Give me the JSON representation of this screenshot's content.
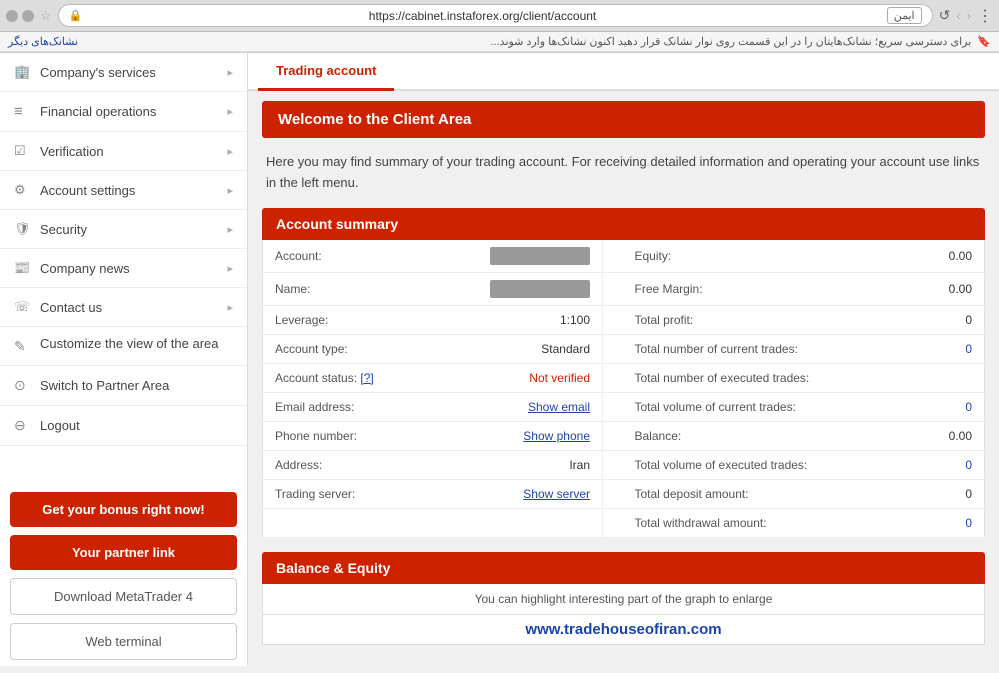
{
  "browser": {
    "url": "https://cabinet.instaforex.org/client/account",
    "security_label": "ایمن",
    "bookmarks_text": "برای دسترسی سریع؛ نشانک‌هایتان را در این قسمت روی نوار نشانک قرار دهید اکنون نشانک‌ها وارد شوند...",
    "bookmarks_label": "نشانک‌های دیگر"
  },
  "sidebar": {
    "items": [
      {
        "id": "company-services",
        "icon": "🏢",
        "label": "Company's services",
        "has_arrow": true
      },
      {
        "id": "financial-operations",
        "icon": "≡",
        "label": "Financial operations",
        "has_arrow": true
      },
      {
        "id": "verification",
        "icon": "☑",
        "label": "Verification",
        "has_arrow": true
      },
      {
        "id": "account-settings",
        "icon": "⚙",
        "label": "Account settings",
        "has_arrow": true
      },
      {
        "id": "security",
        "icon": "🛡",
        "label": "Security",
        "has_arrow": true
      },
      {
        "id": "company-news",
        "icon": "📰",
        "label": "Company news",
        "has_arrow": true
      },
      {
        "id": "contact-us",
        "icon": "☏",
        "label": "Contact us",
        "has_arrow": true
      },
      {
        "id": "customize",
        "icon": "✎",
        "label": "Customize the view of the area",
        "has_arrow": false
      },
      {
        "id": "switch-partner",
        "icon": "⊙",
        "label": "Switch to Partner Area",
        "has_arrow": false
      },
      {
        "id": "logout",
        "icon": "⊖",
        "label": "Logout",
        "has_arrow": false
      }
    ],
    "bonus_button": "Get your bonus right now!",
    "partner_link_button": "Your partner link",
    "download_mt4_button": "Download MetaTrader 4",
    "web_terminal_button": "Web terminal"
  },
  "tabs": [
    {
      "id": "trading-account",
      "label": "Trading account",
      "active": true
    },
    {
      "id": "other",
      "label": "",
      "active": false
    }
  ],
  "welcome": {
    "banner": "Welcome to the Client Area",
    "intro": "Here you may find summary of your trading account. For receiving detailed information and operating your account use links in the left menu."
  },
  "account_summary": {
    "title": "Account summary",
    "left": [
      {
        "label": "Account:",
        "value": "masked",
        "type": "masked"
      },
      {
        "label": "Name:",
        "value": "masked",
        "type": "masked"
      },
      {
        "label": "Leverage:",
        "value": "1:100",
        "type": "text"
      },
      {
        "label": "Account type:",
        "value": "Standard",
        "type": "text"
      },
      {
        "label": "Account status: [?]",
        "value": "Not verified",
        "type": "red"
      },
      {
        "label": "Email address:",
        "value": "Show email",
        "type": "link"
      },
      {
        "label": "Phone number:",
        "value": "Show phone",
        "type": "link"
      },
      {
        "label": "Address:",
        "value": "Iran",
        "type": "text"
      },
      {
        "label": "Trading server:",
        "value": "Show server",
        "type": "link"
      }
    ],
    "right": [
      {
        "label": "Equity:",
        "value": "0.00",
        "type": "text"
      },
      {
        "label": "Free Margin:",
        "value": "0.00",
        "type": "text"
      },
      {
        "label": "Total profit:",
        "value": "0",
        "type": "text"
      },
      {
        "label": "Total number of current trades:",
        "value": "0",
        "type": "blue"
      },
      {
        "label": "Total number of executed trades:",
        "value": "",
        "type": "text"
      },
      {
        "label": "Total volume of current trades:",
        "value": "0",
        "type": "blue"
      },
      {
        "label": "Balance:",
        "value": "0.00",
        "type": "text"
      },
      {
        "label": "Total volume of executed trades:",
        "value": "0",
        "type": "blue"
      },
      {
        "label": "Total deposit amount:",
        "value": "0",
        "type": "text"
      },
      {
        "label": "Total withdrawal amount:",
        "value": "0",
        "type": "blue"
      }
    ]
  },
  "balance_equity": {
    "title": "Balance & Equity",
    "note": "You can highlight interesting part of the graph to enlarge",
    "watermark": "www.tradehouseofiran.com"
  }
}
